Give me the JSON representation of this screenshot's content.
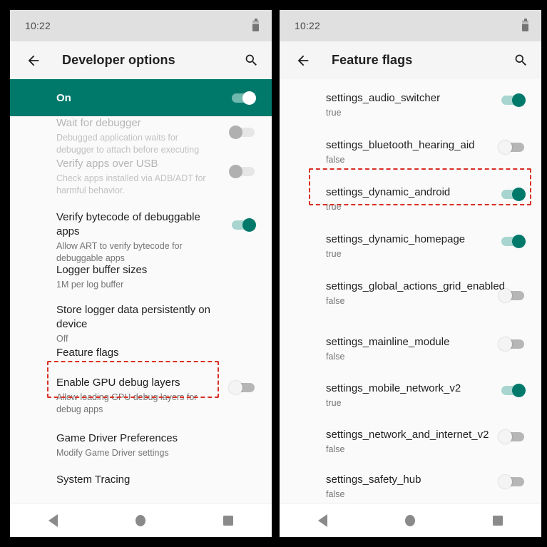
{
  "left_phone": {
    "status_bar": {
      "clock": "10:22",
      "battery_icon": "battery-icon"
    },
    "app_bar": {
      "back_icon": "back-arrow-icon",
      "title": "Developer options",
      "search_icon": "search-icon"
    },
    "master_switch": {
      "label": "On",
      "state": "on"
    },
    "rows": [
      {
        "title": "Wait for debugger",
        "summary": "Debugged application waits for debugger to attach before executing",
        "switch": "disabled",
        "dim": true
      },
      {
        "title": "Verify apps over USB",
        "summary": "Check apps installed via ADB/ADT for harmful behavior.",
        "switch": "disabled",
        "dim": true
      },
      {
        "title": "Verify bytecode of debuggable apps",
        "summary": "Allow ART to verify bytecode for debuggable apps",
        "switch": "on",
        "dim": false
      },
      {
        "title": "Logger buffer sizes",
        "summary": "1M per log buffer",
        "switch": "none",
        "dim": false
      },
      {
        "title": "Store logger data persistently on device",
        "summary": "Off",
        "switch": "none",
        "dim": false
      },
      {
        "title": "Feature flags",
        "summary": "",
        "switch": "none",
        "dim": false,
        "highlighted": true
      },
      {
        "title": "Enable GPU debug layers",
        "summary": "Allow loading GPU debug layers for debug apps",
        "switch": "off",
        "dim": false
      },
      {
        "title": "Game Driver Preferences",
        "summary": "Modify Game Driver settings",
        "switch": "none",
        "dim": false
      },
      {
        "title": "System Tracing",
        "summary": "",
        "switch": "none",
        "dim": false
      }
    ],
    "nav_bar": {
      "back_icon": "nav-back-icon",
      "home_icon": "nav-home-icon",
      "recents_icon": "nav-recents-icon"
    }
  },
  "right_phone": {
    "status_bar": {
      "clock": "10:22",
      "battery_icon": "battery-icon"
    },
    "app_bar": {
      "back_icon": "back-arrow-icon",
      "title": "Feature flags",
      "search_icon": "search-icon"
    },
    "rows": [
      {
        "title": "settings_audio_switcher",
        "summary": "true",
        "switch": "on"
      },
      {
        "title": "settings_bluetooth_hearing_aid",
        "summary": "false",
        "switch": "off"
      },
      {
        "title": "settings_dynamic_android",
        "summary": "true",
        "switch": "on",
        "highlighted": true
      },
      {
        "title": "settings_dynamic_homepage",
        "summary": "true",
        "switch": "on"
      },
      {
        "title": "settings_global_actions_grid_enabled",
        "summary": "false",
        "switch": "off"
      },
      {
        "title": "settings_mainline_module",
        "summary": "false",
        "switch": "off"
      },
      {
        "title": "settings_mobile_network_v2",
        "summary": "true",
        "switch": "on"
      },
      {
        "title": "settings_network_and_internet_v2",
        "summary": "false",
        "switch": "off"
      },
      {
        "title": "settings_safety_hub",
        "summary": "false",
        "switch": "off"
      }
    ],
    "nav_bar": {
      "back_icon": "nav-back-icon",
      "home_icon": "nav-home-icon",
      "recents_icon": "nav-recents-icon"
    }
  },
  "colors": {
    "accent_teal": "#00796b",
    "highlight_red": "#d93025",
    "status_bar_bg": "#e0e0e0",
    "app_bar_bg": "#f5f5f5",
    "page_bg": "#fafafa"
  }
}
